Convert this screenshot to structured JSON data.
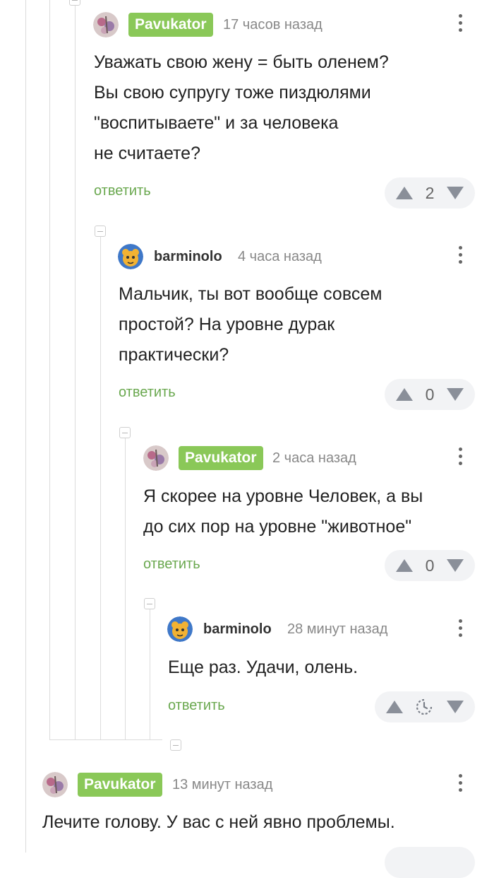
{
  "comments": [
    {
      "username": "Pavukator",
      "author_badge": true,
      "time": "17 часов назад",
      "lines": [
        "Уважать свою жену = быть оленем?",
        "Вы свою супругу тоже пиздюлями",
        "\"воспитываете\" и за человека",
        "не считаете?"
      ],
      "reply_label": "ответить",
      "rating": "2"
    },
    {
      "username": "barminolo",
      "author_badge": false,
      "time": "4 часа назад",
      "lines": [
        "Мальчик, ты вот вообще совсем",
        "простой? На уровне дурак",
        "практически?"
      ],
      "reply_label": "ответить",
      "rating": "0"
    },
    {
      "username": "Pavukator",
      "author_badge": true,
      "time": "2 часа назад",
      "lines": [
        "Я скорее на уровне Человек, а вы",
        "до сих пор на уровне \"животное\""
      ],
      "reply_label": "ответить",
      "rating": "0"
    },
    {
      "username": "barminolo",
      "author_badge": false,
      "time": "28 минут назад",
      "lines": [
        "Еще раз. Удачи, олень."
      ],
      "reply_label": "ответить",
      "rating_pending": true,
      "rating_icon": "clock-pending-icon"
    },
    {
      "username": "Pavukator",
      "author_badge": true,
      "time": "13 минут назад",
      "lines": [
        "Лечите голову. У вас с ней явно проблемы."
      ]
    }
  ],
  "colors": {
    "author_badge": "#8ac858",
    "reply_link": "#6aa84f",
    "thread_line": "#dcdcdc",
    "vote_pill": "#f2f3f5",
    "vote_arrow": "#8a8f99"
  }
}
